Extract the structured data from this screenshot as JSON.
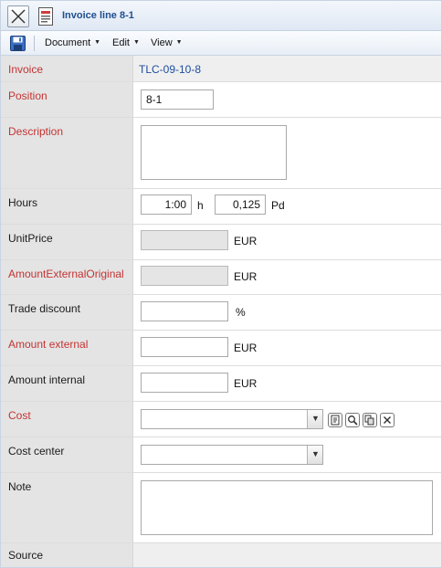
{
  "window": {
    "title": "Invoice line 8-1"
  },
  "menu": {
    "items": [
      "Document",
      "Edit",
      "View"
    ]
  },
  "form": {
    "invoice": {
      "label": "Invoice",
      "value": "TLC-09-10-8"
    },
    "position": {
      "label": "Position",
      "value": "8-1"
    },
    "description": {
      "label": "Description",
      "value": ""
    },
    "hours": {
      "label": "Hours",
      "value": "1:00",
      "unit": "h",
      "pd_value": "0,125",
      "pd_unit": "Pd"
    },
    "unit_price": {
      "label": "UnitPrice",
      "value": "",
      "unit": "EUR"
    },
    "amount_external_original": {
      "label": "AmountExternalOriginal",
      "value": "",
      "unit": "EUR"
    },
    "trade_discount": {
      "label": "Trade discount",
      "value": "",
      "unit": "%"
    },
    "amount_external": {
      "label": "Amount external",
      "value": "",
      "unit": "EUR"
    },
    "amount_internal": {
      "label": "Amount internal",
      "value": "",
      "unit": "EUR"
    },
    "cost": {
      "label": "Cost",
      "value": ""
    },
    "cost_center": {
      "label": "Cost center",
      "value": ""
    },
    "note": {
      "label": "Note",
      "value": ""
    },
    "source": {
      "label": "Source",
      "value": ""
    }
  },
  "icons": {
    "close": "close-icon",
    "document": "document-icon",
    "save": "save-icon",
    "dropdown": "chevron-down-icon",
    "new": "new-record-icon",
    "search": "search-icon",
    "copy": "copy-icon",
    "clear": "clear-icon"
  },
  "colors": {
    "required_label": "#c43333",
    "link": "#1d4ea0",
    "title": "#1f4f8f"
  }
}
